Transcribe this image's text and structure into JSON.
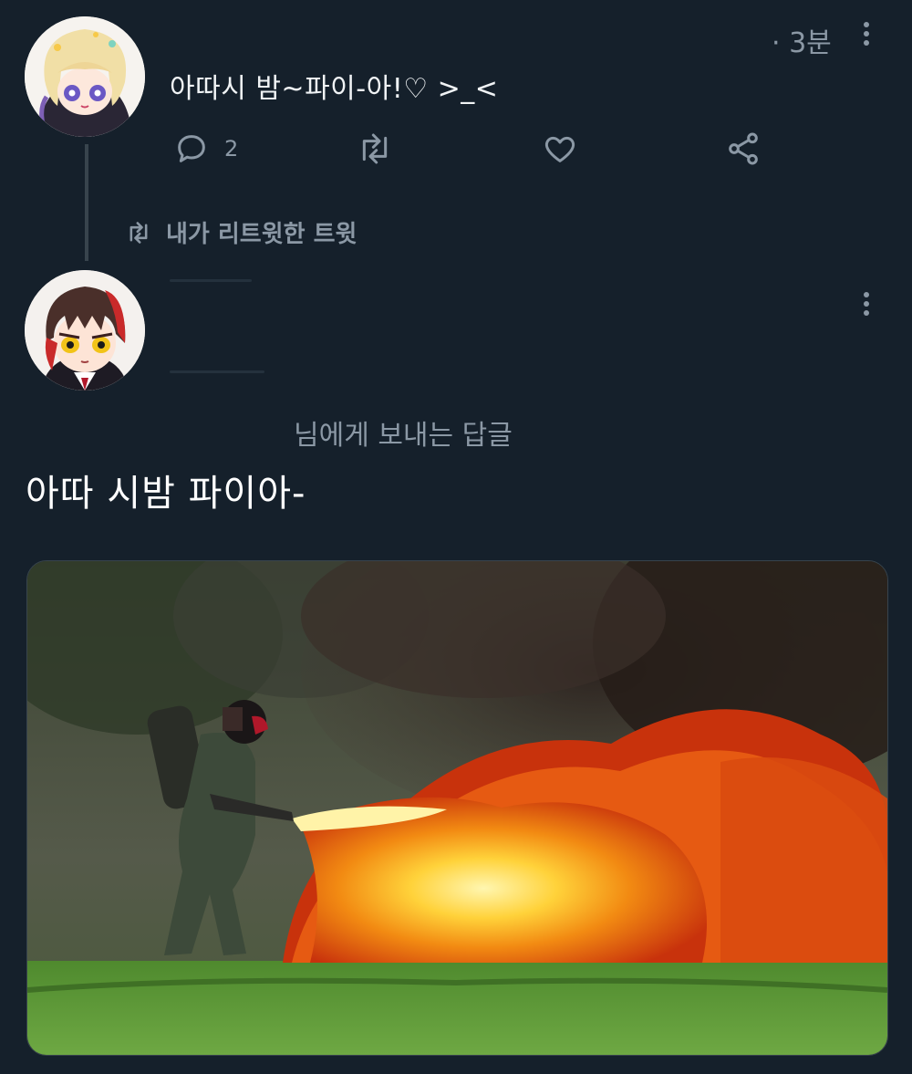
{
  "colors": {
    "background": "#15202b",
    "muted": "#8b98a5",
    "text": "#ffffff"
  },
  "tweet1": {
    "time": "· 3분",
    "text": "아따시 밤~파이-아!♡ >_<",
    "reply_count": "2"
  },
  "retweet_label": "내가 리트윗한 트윗",
  "tweet2": {
    "reply_to": "님에게 보내는 답글",
    "text": "아따 시밤 파이아-"
  },
  "icons": [
    "reply-icon",
    "retweet-icon",
    "like-icon",
    "share-icon",
    "more-icon"
  ]
}
